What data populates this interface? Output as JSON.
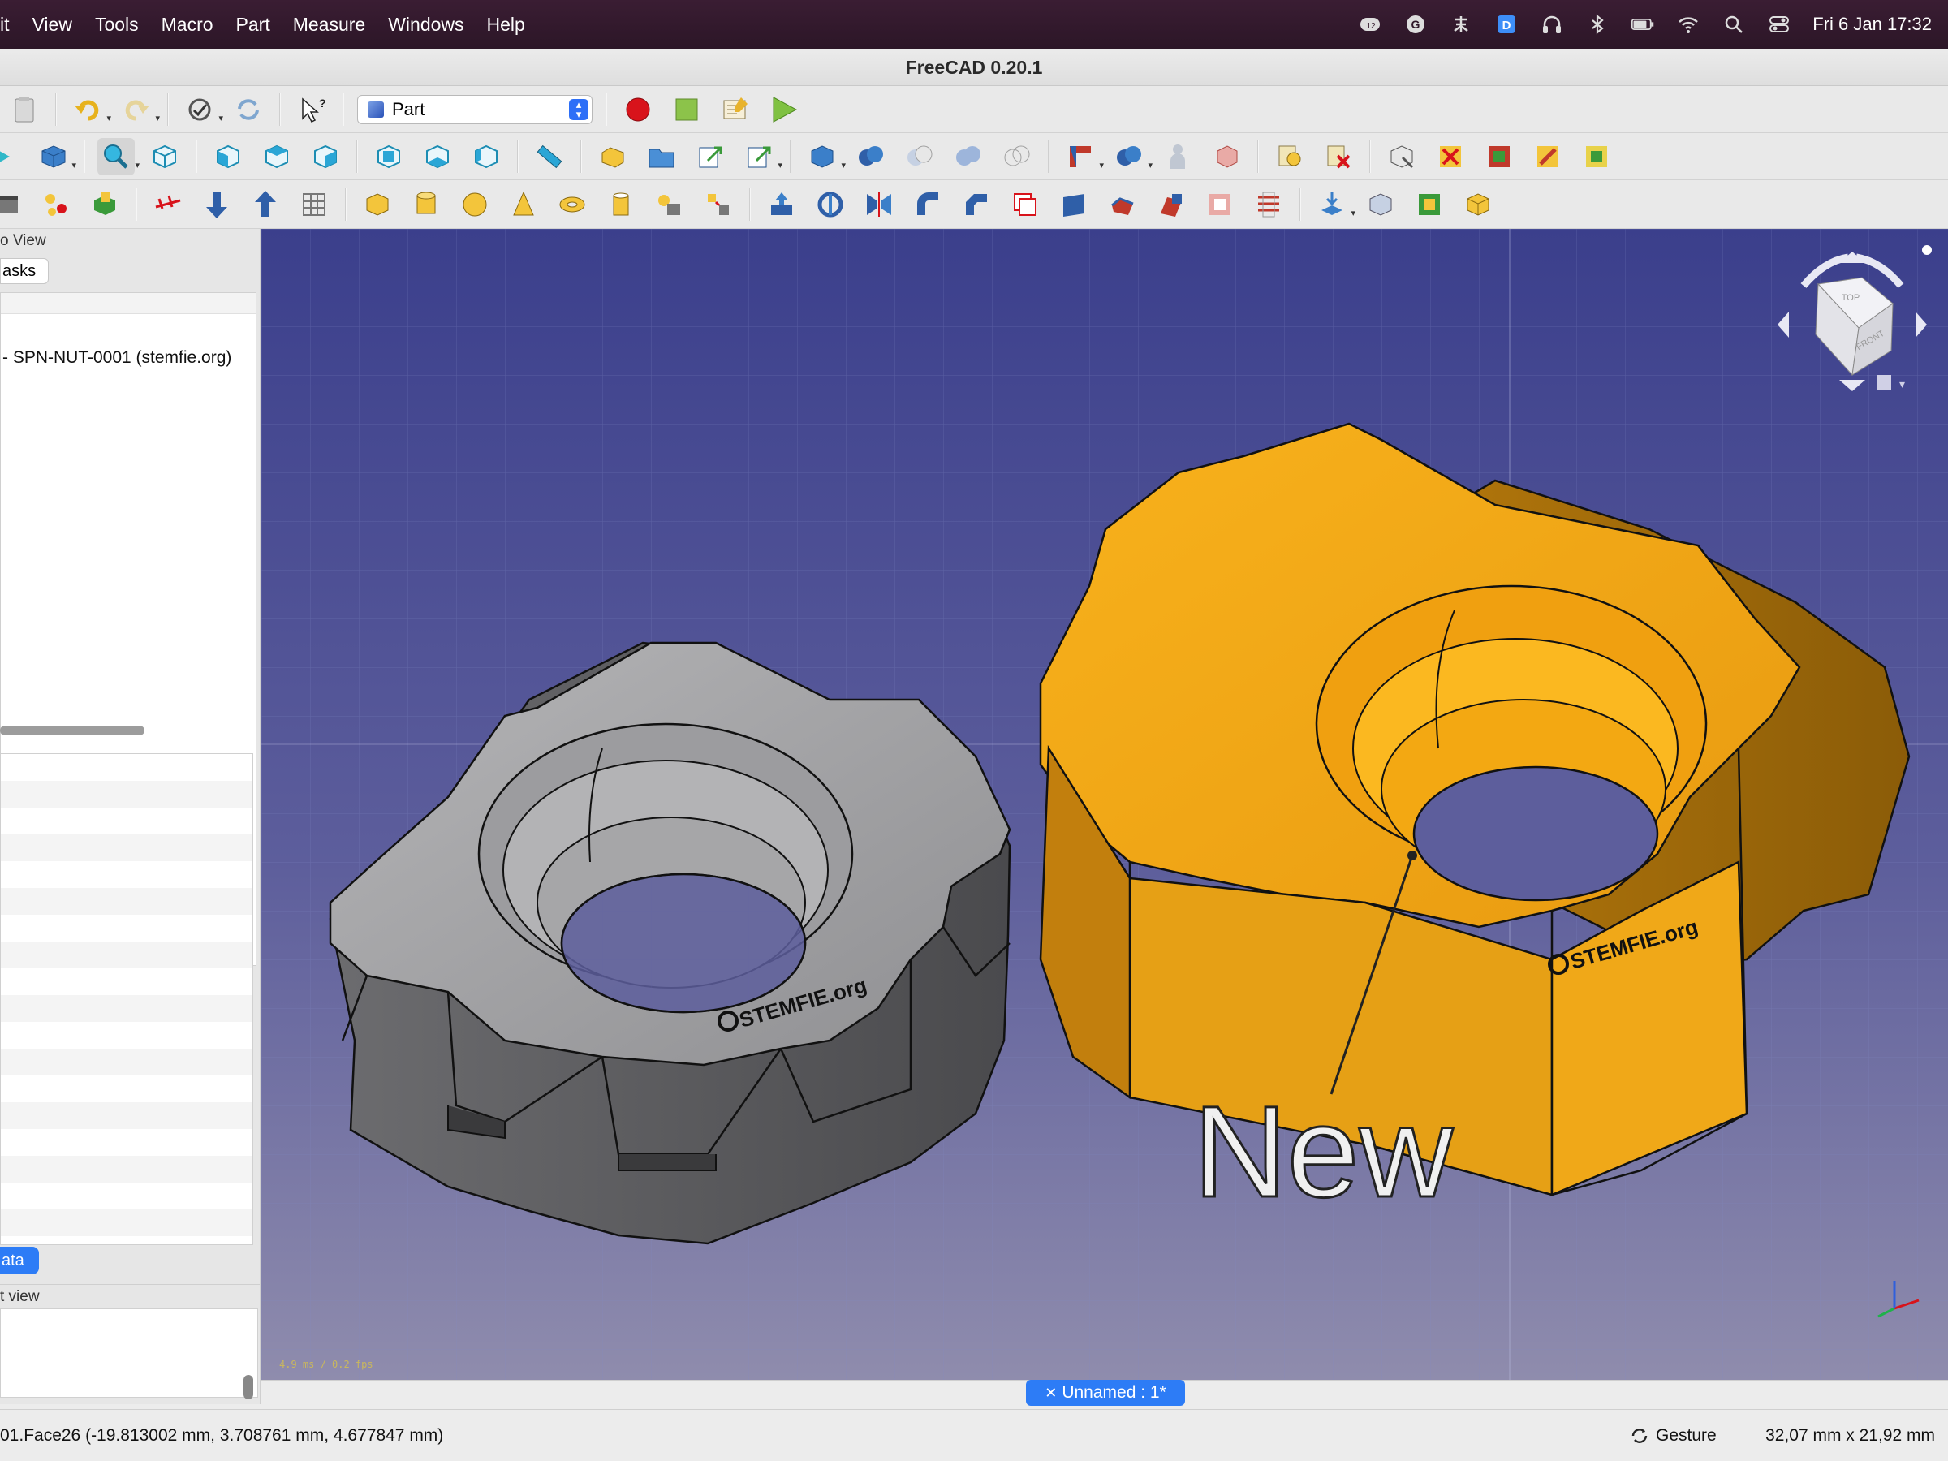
{
  "menubar": {
    "items": [
      "it",
      "View",
      "Tools",
      "Macro",
      "Part",
      "Measure",
      "Windows",
      "Help"
    ],
    "notification_badge": "12",
    "datetime": "Fri 6 Jan  17:32",
    "icons": [
      "notification-icon",
      "grammarly-icon",
      "chinese-input-icon",
      "d-app-icon",
      "headphones-icon",
      "bluetooth-icon",
      "battery-icon",
      "wifi-icon",
      "spotlight-search-icon",
      "control-center-icon"
    ]
  },
  "window": {
    "title": "FreeCAD 0.20.1"
  },
  "toolbar": {
    "workbench": "Part",
    "icons_row1": [
      "paste-icon",
      "undo-icon",
      "redo-icon",
      "refresh-icon",
      "whats-this-icon",
      "record-macro-icon",
      "stop-macro-icon",
      "edit-macro-icon",
      "run-macro-icon"
    ],
    "icons_row2": [
      "std-views-icon",
      "fit-all-icon",
      "isometric-view-icon",
      "front-view-icon",
      "top-view-icon",
      "right-view-icon",
      "rear-view-icon",
      "bottom-view-icon",
      "left-view-icon",
      "measure-distance-icon",
      "part-icon",
      "group-icon",
      "link-icon",
      "link-actions-icon",
      "box-selection-icon",
      "boolean-icon",
      "cut-icon",
      "fuse-icon",
      "common-icon",
      "section-icon",
      "join-icon",
      "split-icon",
      "compound-icon",
      "check-geometry-icon",
      "defeaturing-icon",
      "measure-linear-icon",
      "measure-angular-icon",
      "measure-clear-icon",
      "measure-toggle-icon",
      "measure-3d-icon"
    ],
    "icons_row3": [
      "primitives-icon",
      "shape-builder-icon",
      "extrude-icon",
      "mirror-icon",
      "create-box-icon",
      "create-cylinder-icon",
      "create-sphere-icon",
      "create-cone-icon",
      "create-torus-icon",
      "create-tube-icon",
      "primitives-dialog-icon",
      "shape-builder-2-icon",
      "extrude-2-icon",
      "revolve-icon",
      "mirror-2-icon",
      "fillet-icon",
      "chamfer-icon",
      "make-face-icon",
      "ruled-surface-icon",
      "loft-icon",
      "sweep-icon",
      "section-2-icon",
      "cross-sections-icon",
      "offset-icon",
      "thickness-icon",
      "projection-icon",
      "attachment-icon"
    ]
  },
  "panel": {
    "combo_title": "o View",
    "tasks_tab": "asks",
    "tree_item": "- SPN-NUT-0001 (stemfie.org)",
    "data_tab": "ata",
    "report_view_title": "t view"
  },
  "viewport": {
    "annotation": "New",
    "logo_text": "STEMFIE.org",
    "fps": "4.9 ms / 0.2 fps",
    "navcube_faces": [
      "TOP",
      "FRONT"
    ]
  },
  "document_tab": {
    "label": "Unnamed : 1*"
  },
  "statusbar": {
    "message": "01.Face26 (-19.813002 mm, 3.708761 mm, 4.677847 mm)",
    "navigation_style": "Gesture",
    "dimensions": "32,07 mm x 21,92 mm"
  },
  "colors": {
    "menubar": "#2f1729",
    "viewport_top": "#3b3f8c",
    "viewport_bottom": "#8f8cad",
    "orange_nut": "#f5a516",
    "gray_nut": "#a7a7a9",
    "accent_blue": "#2d7cf6"
  }
}
